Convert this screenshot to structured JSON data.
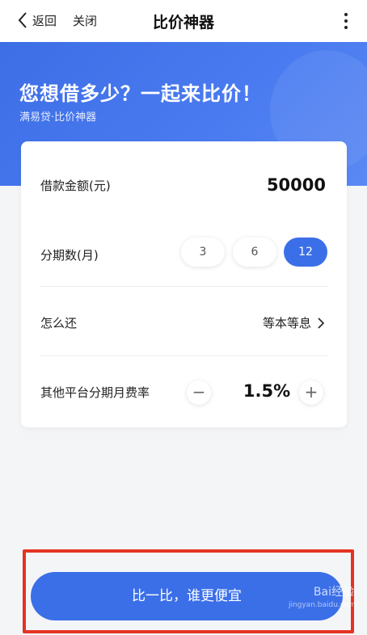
{
  "header": {
    "back_label": "返回",
    "close_label": "关闭",
    "title": "比价神器"
  },
  "banner": {
    "headline": "您想借多少？一起来比价！",
    "subtitle": "满易贷·比价神器"
  },
  "form": {
    "amount": {
      "label": "借款金额(元)",
      "value": "50000"
    },
    "periods": {
      "label": "分期数(月)",
      "options": [
        "3",
        "6",
        "12"
      ],
      "selected": "12"
    },
    "repayment": {
      "label": "怎么还",
      "value": "等本等息"
    },
    "rate": {
      "label": "其他平台分期月费率",
      "value": "1.5%",
      "minus": "−",
      "plus": "+"
    }
  },
  "cta": {
    "label": "比一比，谁更便宜"
  },
  "watermark": {
    "text": "Bai经验",
    "sub": "jingyan.baidu.com"
  },
  "colors": {
    "accent": "#3b6fe8",
    "highlight_frame": "#e53323"
  }
}
